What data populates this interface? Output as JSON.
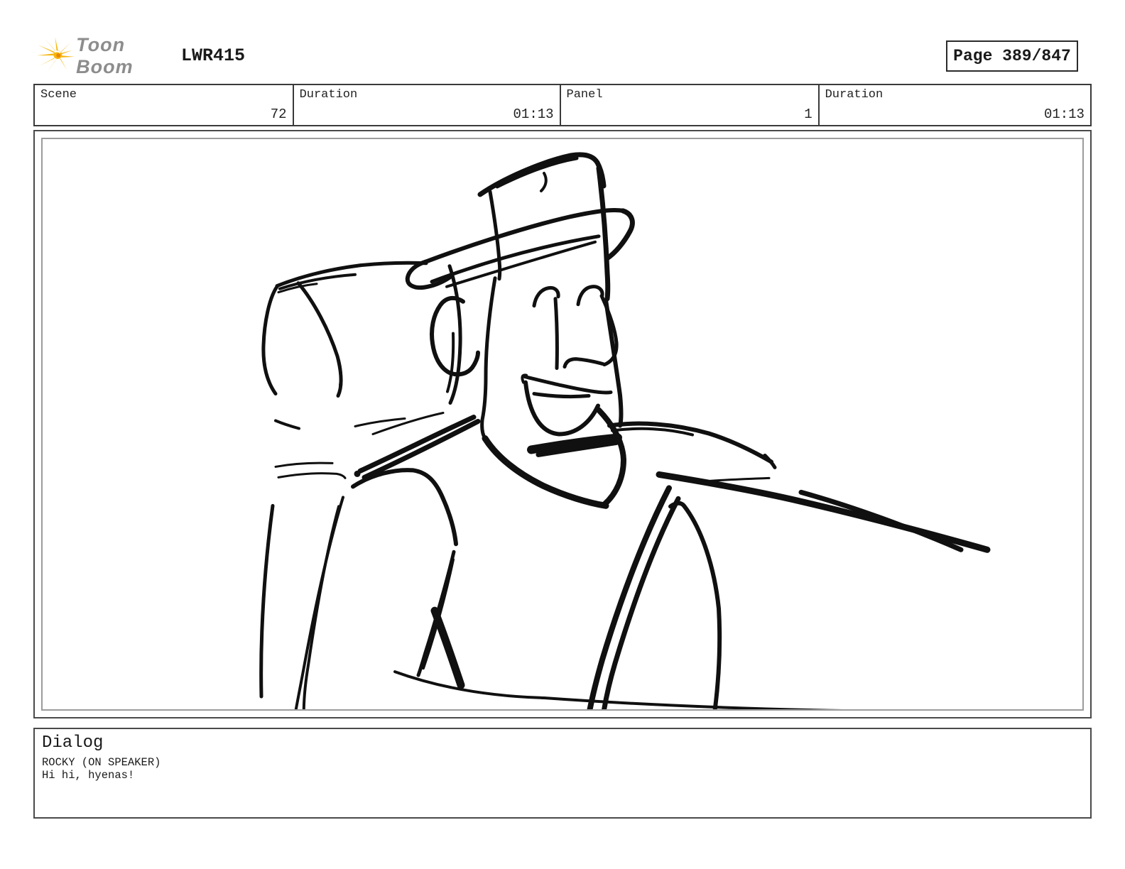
{
  "header": {
    "logo_text": "Toon Boom",
    "project_title": "LWR415",
    "page_label": "Page 389/847"
  },
  "info": {
    "cells": [
      {
        "label": "Scene",
        "value": "72"
      },
      {
        "label": "Duration",
        "value": "01:13"
      },
      {
        "label": "Panel",
        "value": "1"
      },
      {
        "label": "Duration",
        "value": "01:13"
      }
    ]
  },
  "panel": {
    "description": "Rough black-ink storyboard sketch: smiling man wearing a fedora hat seated next to a car-seat headrest, seat belt across chest, one arm extended to the right"
  },
  "dialog": {
    "heading": "Dialog",
    "character": "ROCKY (ON SPEAKER)",
    "line": "Hi hi, hyenas!"
  },
  "colors": {
    "logo_yellow": "#F6B60E",
    "logo_orange": "#E8860C",
    "logo_text_gray": "#8d8d8d",
    "sketch_stroke": "#101010",
    "frame_dark": "#4a4a4a",
    "frame_light": "#9c9c9c"
  }
}
